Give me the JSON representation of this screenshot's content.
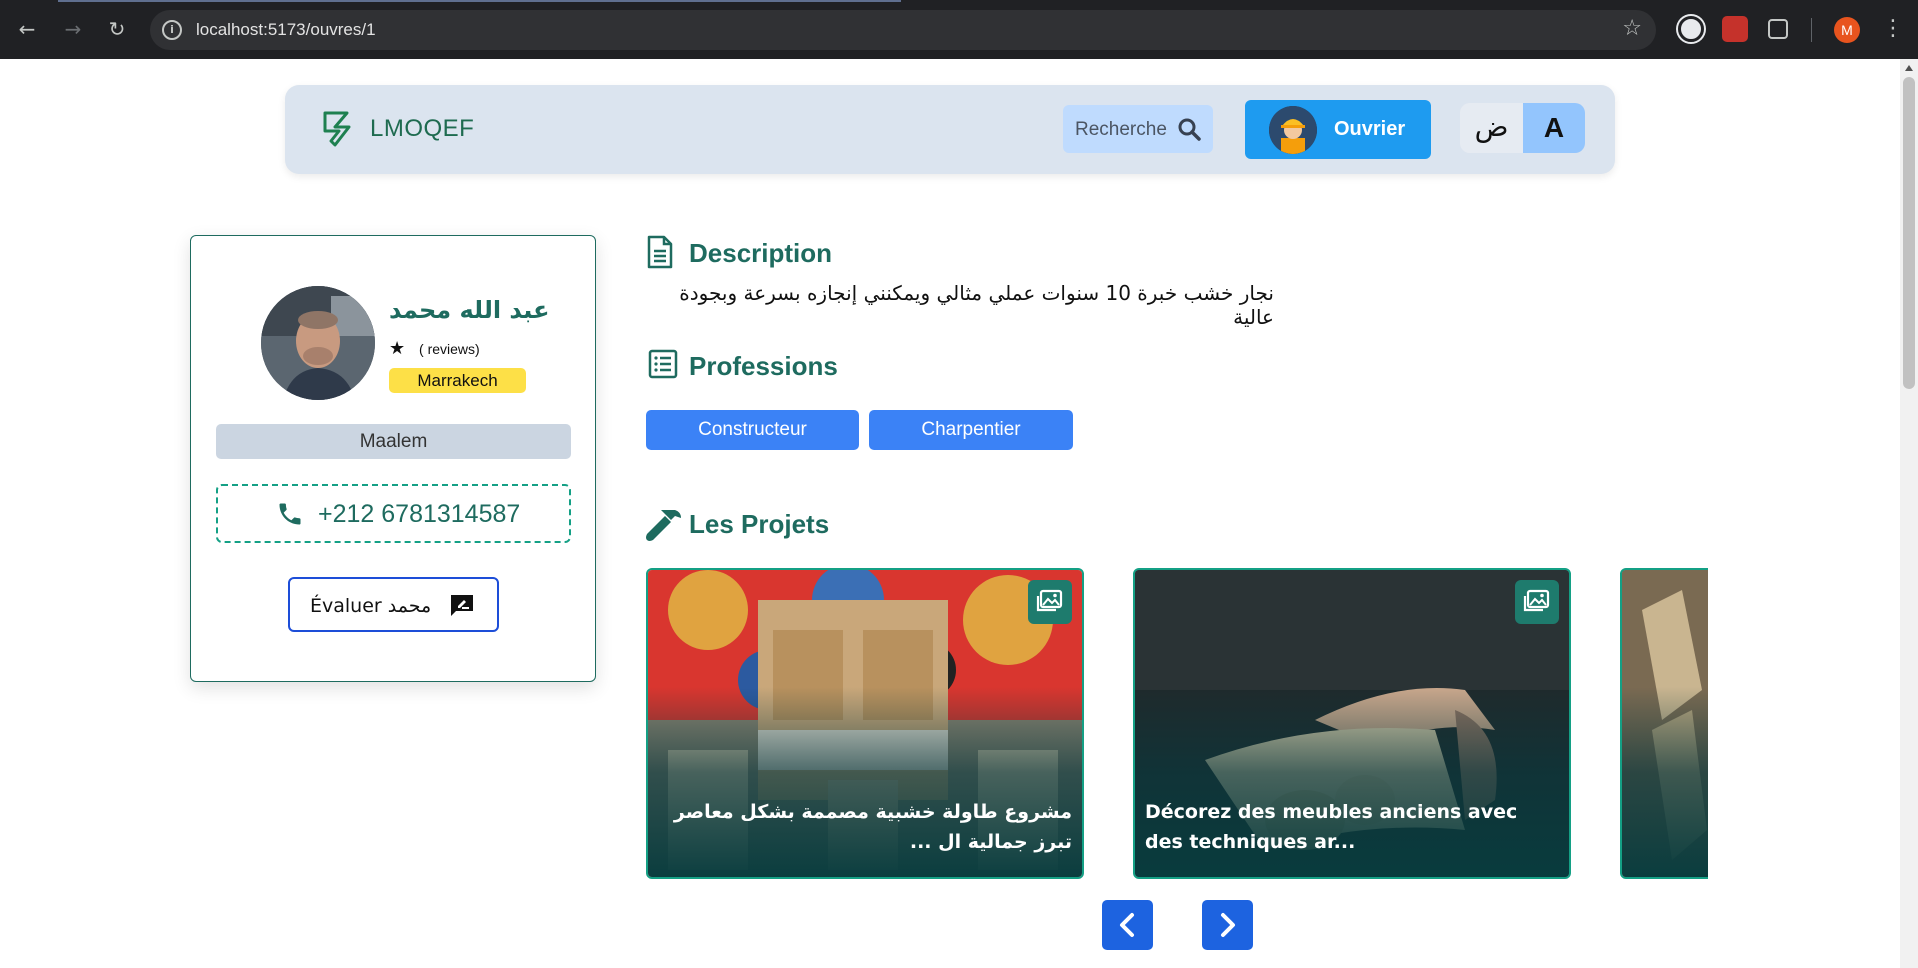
{
  "browser": {
    "url": "localhost:5173/ouvres/1",
    "profile_initial": "M"
  },
  "navbar": {
    "logo_text": "LMOQEF",
    "search_label": "Recherche",
    "role_button_label": "Ouvrier",
    "lang_ar_label": "ض",
    "lang_fr_label": "A"
  },
  "profile": {
    "name": "عبد الله محمد",
    "reviews_text": "( reviews)",
    "city": "Marrakech",
    "rank": "Maalem",
    "phone": "+212 6781314587",
    "rate_button_label": "Évaluer محمد"
  },
  "description": {
    "title": "Description",
    "text": "نجار خشب خبرة 10 سنوات عملي مثالي ويمكنني إنجازه بسرعة وبجودة عالية"
  },
  "professions": {
    "title": "Professions",
    "items": [
      "Constructeur",
      "Charpentier"
    ]
  },
  "projects": {
    "title": "Les Projets",
    "items": [
      {
        "caption": "مشروع طاولة خشبية مصممة بشكل معاصر تبرز جمالية ال ..."
      },
      {
        "caption": "Décorez des meubles anciens avec des techniques ar..."
      },
      {
        "caption": ""
      }
    ]
  },
  "colors": {
    "brand_green": "#1e6b5f",
    "primary_blue": "#3b82f6",
    "navbar_bg": "#dbe4ef",
    "city_badge": "#fde047"
  }
}
